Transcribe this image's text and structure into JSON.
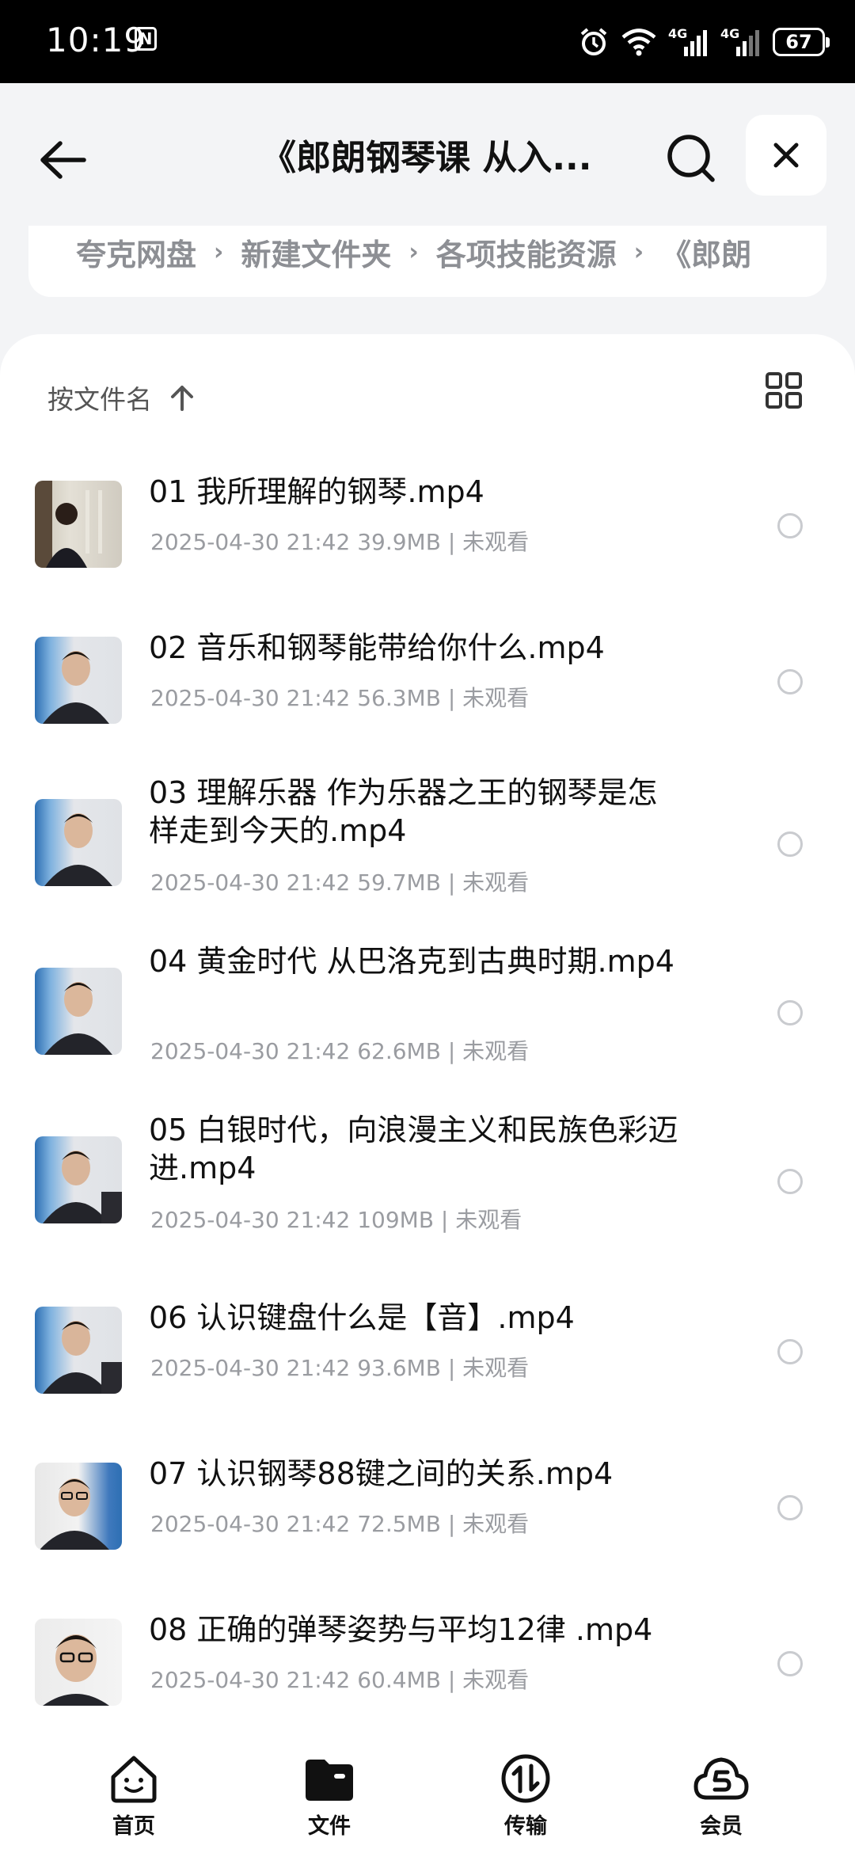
{
  "status": {
    "time": "10:19",
    "battery": "67",
    "net1": "4G",
    "net2": "4G"
  },
  "header": {
    "title": "《郎朗钢琴课 从入..."
  },
  "breadcrumb": [
    "夸克网盘",
    "新建文件夹",
    "各项技能资源",
    "《郎朗"
  ],
  "sort": {
    "label": "按文件名"
  },
  "files": [
    {
      "name": "01 我所理解的钢琴.mp4",
      "meta": "2025-04-30 21:42  39.9MB | 未观看"
    },
    {
      "name": "02 音乐和钢琴能带给你什么.mp4",
      "meta": "2025-04-30 21:42  56.3MB | 未观看"
    },
    {
      "name": "03 理解乐器 作为乐器之王的钢琴是怎样走到今天的.mp4",
      "meta": "2025-04-30 21:42  59.7MB | 未观看"
    },
    {
      "name": "04 黄金时代 从巴洛克到古典时期.mp4",
      "meta": "2025-04-30 21:42  62.6MB | 未观看"
    },
    {
      "name": "05 白银时代，向浪漫主义和民族色彩迈进.mp4",
      "meta": "2025-04-30 21:42  109MB | 未观看"
    },
    {
      "name": "06 认识键盘什么是【音】.mp4",
      "meta": "2025-04-30 21:42  93.6MB | 未观看"
    },
    {
      "name": "07 认识钢琴88键之间的关系.mp4",
      "meta": "2025-04-30 21:42  72.5MB | 未观看"
    },
    {
      "name": "08 正确的弹琴姿势与平均12律 .mp4",
      "meta": "2025-04-30 21:42  60.4MB | 未观看"
    }
  ],
  "tabs": [
    {
      "label": "首页",
      "icon": "home-face-icon"
    },
    {
      "label": "文件",
      "icon": "folder-icon"
    },
    {
      "label": "传输",
      "icon": "transfer-icon"
    },
    {
      "label": "会员",
      "icon": "member-cloud-icon"
    }
  ]
}
